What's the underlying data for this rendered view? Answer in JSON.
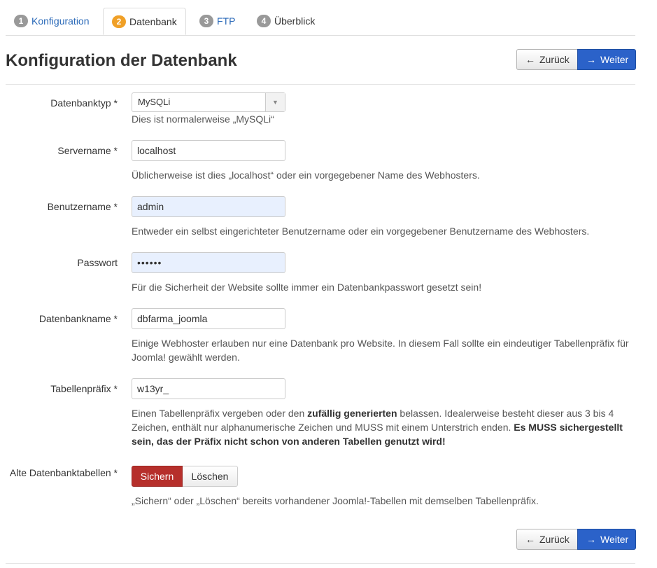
{
  "tabs": [
    {
      "num": "1",
      "label": "Konfiguration"
    },
    {
      "num": "2",
      "label": "Datenbank"
    },
    {
      "num": "3",
      "label": "FTP"
    },
    {
      "num": "4",
      "label": "Überblick"
    }
  ],
  "page": {
    "title": "Konfiguration der Datenbank",
    "back_label": "Zurück",
    "next_label": "Weiter"
  },
  "fields": {
    "dbtype": {
      "label": "Datenbanktyp *",
      "value": "MySQLi",
      "help": "Dies ist normalerweise „MySQLi“"
    },
    "server": {
      "label": "Servername *",
      "value": "localhost",
      "help": "Üblicherweise ist dies „localhost“ oder ein vorgegebener Name des Webhosters."
    },
    "user": {
      "label": "Benutzername *",
      "value": "admin",
      "help": "Entweder ein selbst eingerichteter Benutzername oder ein vorgegebener Benutzername des Webhosters."
    },
    "password": {
      "label": "Passwort",
      "value": "••••••",
      "help": "Für die Sicherheit der Website sollte immer ein Datenbankpasswort gesetzt sein!"
    },
    "dbname": {
      "label": "Datenbankname *",
      "value": "dbfarma_joomla",
      "help": "Einige Webhoster erlauben nur eine Datenbank pro Website. In diesem Fall sollte ein eindeutiger Tabellenpräfix für Joomla! gewählt werden."
    },
    "prefix": {
      "label": "Tabellenpräfix *",
      "value": "w13yr_",
      "help_1": "Einen Tabellenpräfix vergeben oder den ",
      "help_bold_1": "zufällig generierten",
      "help_2": " belassen. Idealerweise besteht dieser aus 3 bis 4 Zeichen, enthält nur alphanumerische Zeichen und MUSS mit einem Unterstrich enden. ",
      "help_bold_2": "Es MUSS sichergestellt sein, das der Präfix nicht schon von anderen Tabellen genutzt wird!"
    },
    "old_tables": {
      "label": "Alte Datenbanktabellen *",
      "option_keep": "Sichern",
      "option_delete": "Löschen",
      "help": "„Sichern“ oder „Löschen“ bereits vorhandener Joomla!-Tabellen mit demselben Tabellenpräfix."
    }
  },
  "icons": {
    "back": "arrow-left-icon",
    "next": "arrow-right-icon",
    "dropdown": "caret-down-icon"
  },
  "colors": {
    "primary": "#2b62c9",
    "danger": "#b62f2b",
    "active_step": "#f0a027",
    "link": "#2a69b8"
  }
}
